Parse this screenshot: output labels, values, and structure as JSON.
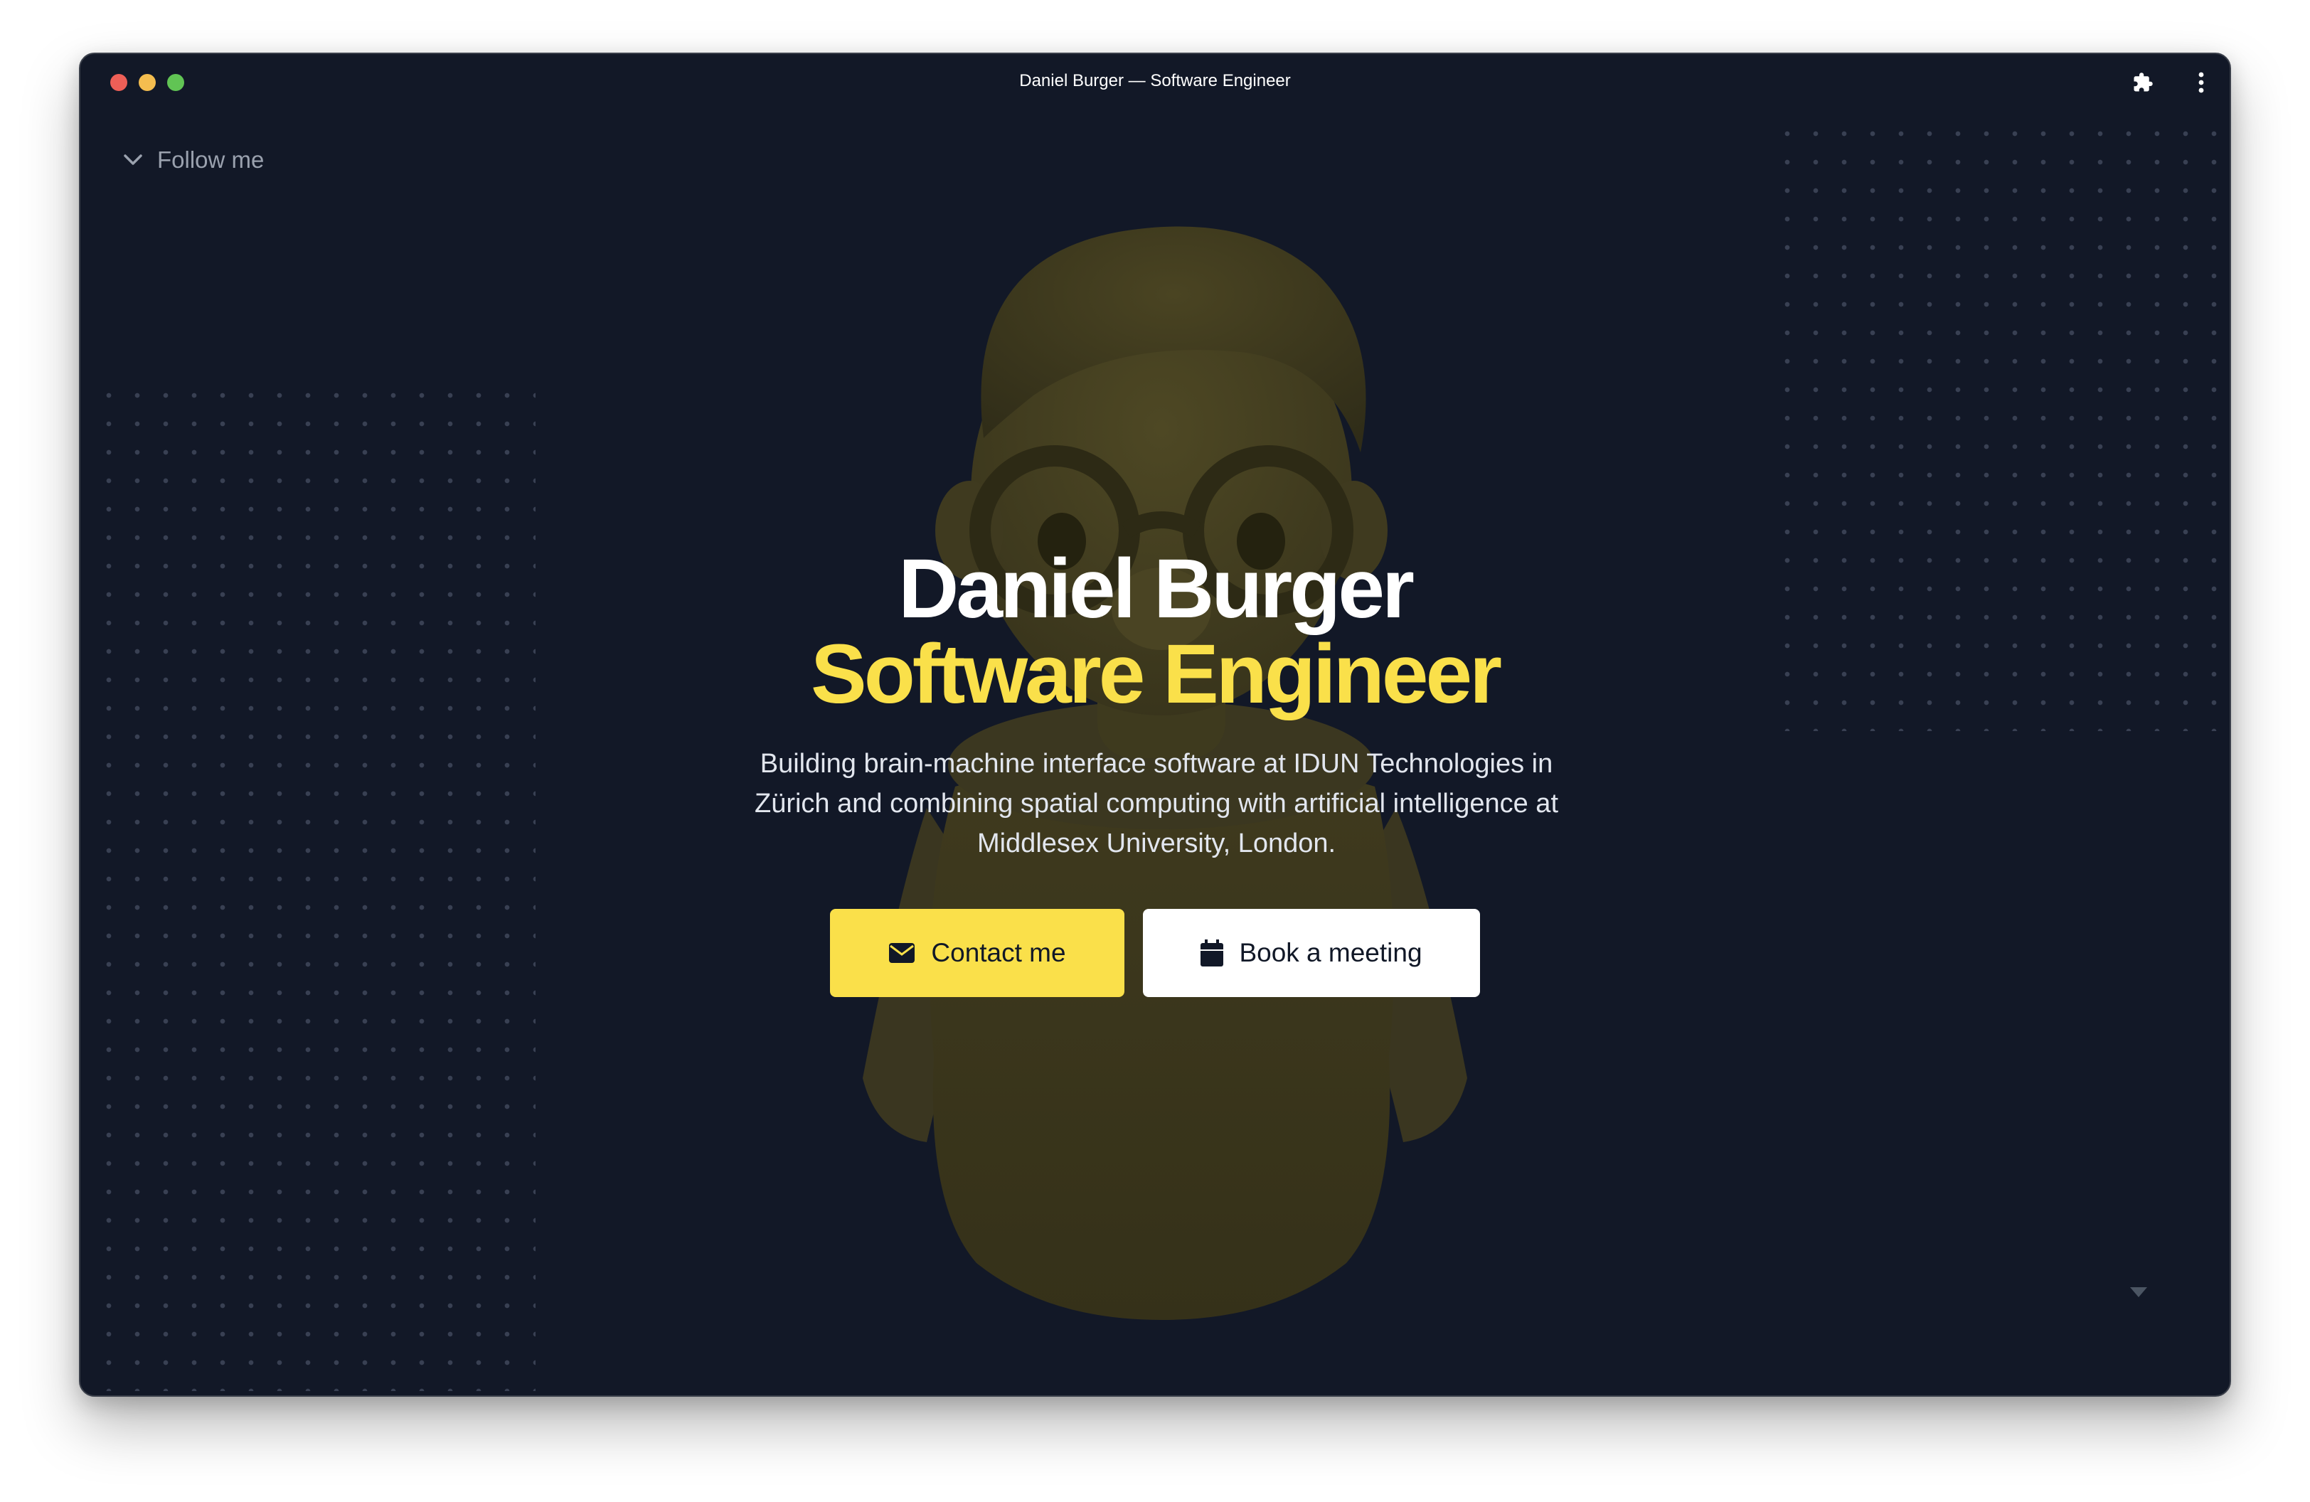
{
  "window": {
    "title": "Daniel Burger — Software Engineer"
  },
  "toolbar": {
    "extensions_icon": "puzzle-icon",
    "menu_icon": "kebab-menu-icon"
  },
  "nav": {
    "follow_label": "Follow me",
    "follow_icon": "chevron-down-icon"
  },
  "hero": {
    "name": "Daniel Burger",
    "role": "Software Engineer",
    "description": "Building brain-machine interface software at IDUN Technologies in Zürich and combining spatial computing with artificial intelligence at Middlesex University, London.",
    "contact_label": "Contact me",
    "contact_icon": "envelope-icon",
    "meeting_label": "Book a meeting",
    "meeting_icon": "calendar-icon",
    "scroll_icon": "caret-down-icon"
  },
  "colors": {
    "background": "#121827",
    "accent": "#fae04a",
    "text": "#ffffff"
  }
}
